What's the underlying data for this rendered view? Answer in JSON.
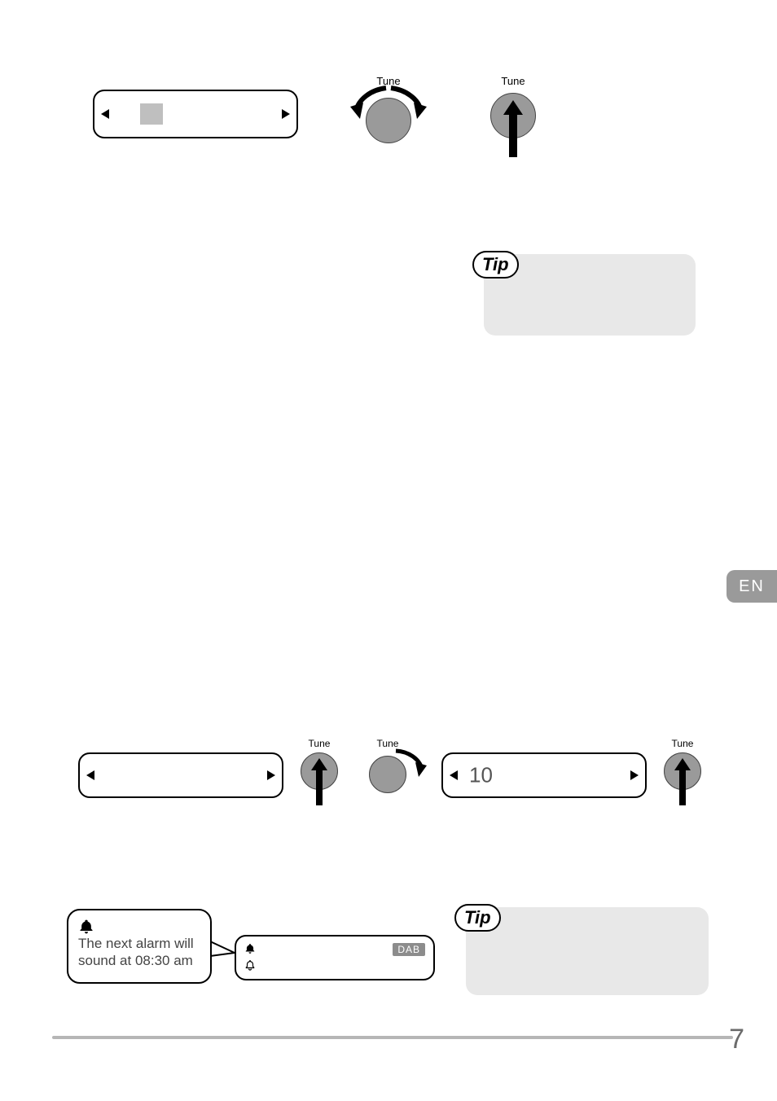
{
  "page_number": "7",
  "language_tab": "EN",
  "labels": {
    "tune": "Tune"
  },
  "tip": {
    "badge": "Tip"
  },
  "nap": {
    "display_value": "10"
  },
  "alarm_confirm": {
    "speech_text": "The next alarm will sound at 08:30 am",
    "mode_badge": "DAB"
  }
}
